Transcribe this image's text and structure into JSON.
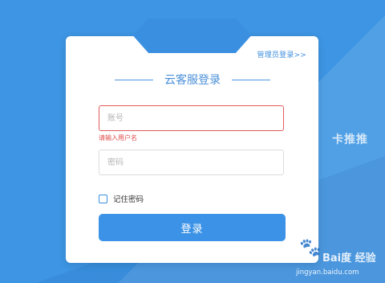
{
  "header": {
    "admin_login_link": "管理员登录>>",
    "title": "云客服登录"
  },
  "form": {
    "account": {
      "placeholder": "账号",
      "value": ""
    },
    "account_error": "请输入用户名",
    "password": {
      "placeholder": "密码",
      "value": ""
    },
    "remember_label": "记住密码",
    "remember_checked": false,
    "login_label": "登录"
  },
  "watermark": {
    "side_text": "卡推推",
    "brand_text": "Bai度 经验",
    "url_text": "jingyan.baidu.com"
  },
  "colors": {
    "background": "#3d95e3",
    "accent": "#3b92e6",
    "error": "#e04a4a"
  },
  "icons": {
    "checkbox": "checkbox-icon",
    "paw": "paw-icon"
  }
}
